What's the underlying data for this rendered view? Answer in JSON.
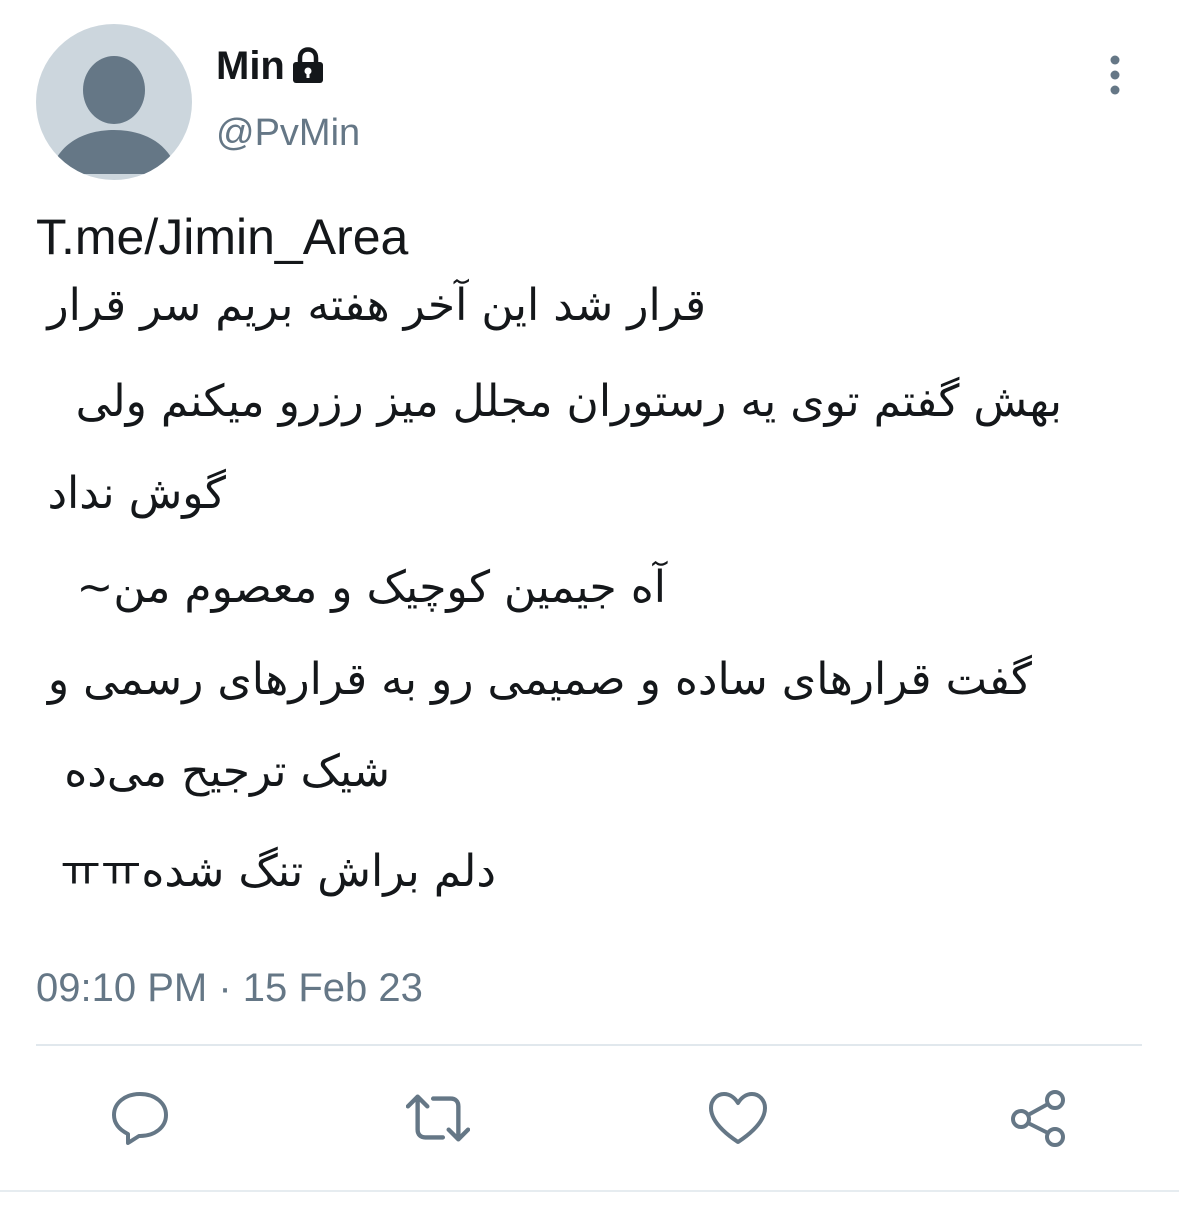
{
  "profile": {
    "display_name": "Min",
    "handle": "@PvMin",
    "avatar_icon": "default-avatar-icon",
    "protected_icon": "lock-icon"
  },
  "tweet": {
    "bio_link": "T.me/Jimin_Area",
    "lines": [
      "قرار شد این آخر هفته بریم سر قرار",
      "بهش گفتم توی یه رستوران مجلل میز رزرو میکنم ولی",
      "گوش نداد",
      "آه جیمین کوچیک و معصوم من~",
      "گفت قرارهای ساده و صمیمی رو به قرارهای رسمی و",
      "شیک ترجیح می‌ده",
      "دلم براش تنگ شدهㅠㅠ"
    ],
    "timestamp": "09:10 PM · 15 Feb 23"
  },
  "actions": {
    "reply_icon": "reply-icon",
    "retweet_icon": "retweet-icon",
    "like_icon": "like-icon",
    "share_icon": "share-icon"
  },
  "colors": {
    "text_primary": "#14171a",
    "text_secondary": "#657786",
    "icon": "#657786",
    "avatar_bg": "#ccd6dd",
    "avatar_fg": "#657786",
    "divider": "#e1e8ed"
  }
}
